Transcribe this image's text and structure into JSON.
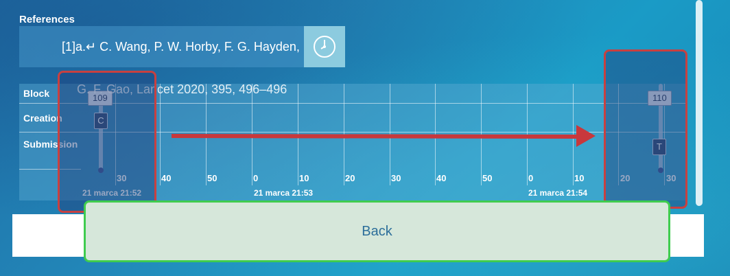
{
  "references": {
    "heading": "References",
    "line1": "[1]a.↵ C. Wang, P. W. Horby, F. G. Hayden,",
    "line2": "G. F. Gao, Lancet 2020, 395, 496–496"
  },
  "clock_icon": "clock-icon",
  "timeline": {
    "rows": [
      "Block",
      "Creation",
      "Submission"
    ],
    "ticks": [
      "30",
      "40",
      "50",
      "0",
      "10",
      "20",
      "30",
      "40",
      "50",
      "0",
      "10",
      "20",
      "30"
    ],
    "time_labels": [
      "21 marca 21:52",
      "21 marca 21:53",
      "21 marca 21:54"
    ],
    "left_slider": {
      "flag": "109",
      "marker": "C"
    },
    "right_slider": {
      "flag": "110",
      "marker": "T"
    }
  },
  "back_button": {
    "label": "Back"
  },
  "colors": {
    "highlight_red": "#c84040",
    "highlight_green": "#3fcc4e",
    "arrow": "#c8383c"
  }
}
